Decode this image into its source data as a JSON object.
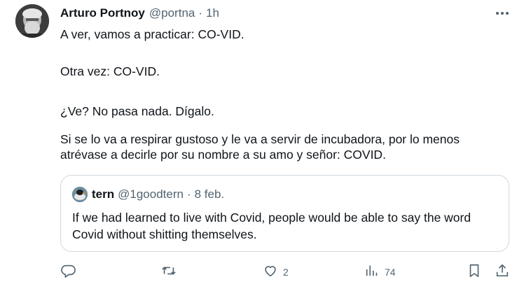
{
  "tweet": {
    "author_name": "Arturo Portnoy",
    "author_handle": "@portna",
    "separator": "·",
    "time": "1h",
    "paragraphs": [
      "A ver, vamos a practicar: CO-VID.",
      "Otra vez: CO-VID.",
      "¿Ve? No pasa nada. Dígalo.",
      "Si se lo va a respirar gustoso y le va a servir de incubadora, por lo menos atrévase a decirle por su nombre a su amo y señor: COVID."
    ]
  },
  "quote": {
    "author_name": "tern",
    "author_handle": "@1goodtern",
    "separator": "·",
    "time": "8 feb.",
    "text": "If we had learned to live with Covid, people would be able to say the word Covid without shitting themselves."
  },
  "actions": {
    "reply_icon": "reply-icon",
    "retweet_icon": "retweet-icon",
    "like_icon": "heart-icon",
    "like_count": "2",
    "views_icon": "views-icon",
    "views_count": "74",
    "bookmark_icon": "bookmark-icon",
    "share_icon": "share-icon"
  },
  "colors": {
    "text": "#0f1419",
    "secondary": "#536471",
    "border": "#cfd9de"
  }
}
